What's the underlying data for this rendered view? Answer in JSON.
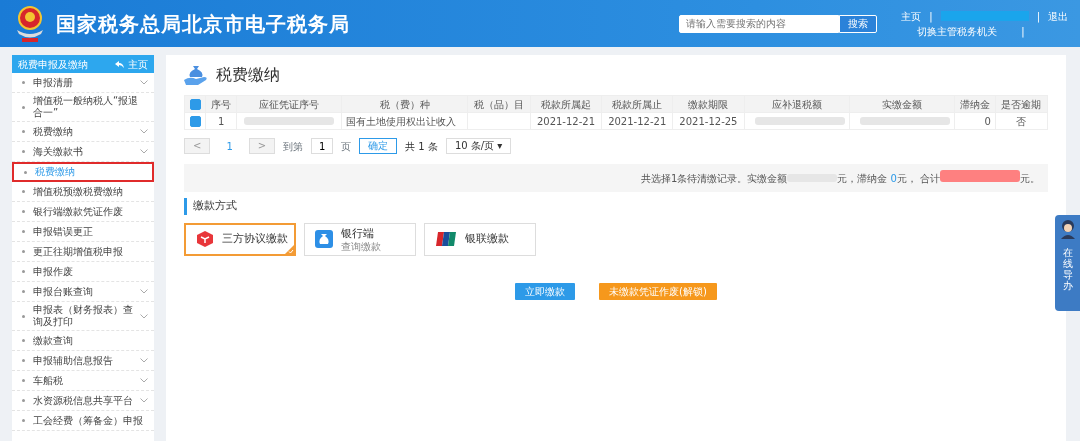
{
  "header": {
    "title": "国家税务总局北京市电子税务局",
    "search": {
      "placeholder": "请输入需要搜索的内容",
      "button": "搜索"
    },
    "links": [
      {
        "kind": "link",
        "text": "主页"
      },
      {
        "kind": "sep",
        "text": "|"
      },
      {
        "kind": "redacted"
      },
      {
        "kind": "sep",
        "text": "|"
      },
      {
        "kind": "link",
        "text": "退出"
      }
    ],
    "switch_link": "切换主管税务机关",
    "switch_sep": "|"
  },
  "sidebar": {
    "title": "税费申报及缴纳",
    "home": "主页",
    "items": [
      {
        "label": "申报清册",
        "expandable": true,
        "selected": false
      },
      {
        "label": "增值税一般纳税人“报退合一”",
        "expandable": false,
        "selected": false
      },
      {
        "label": "税费缴纳",
        "expandable": true,
        "selected": false
      },
      {
        "label": "海关缴款书",
        "expandable": true,
        "selected": false
      },
      {
        "label": "税费缴纳",
        "expandable": false,
        "selected": true
      },
      {
        "label": "增值税预缴税费缴纳",
        "expandable": false,
        "selected": false
      },
      {
        "label": "银行端缴款凭证作废",
        "expandable": false,
        "selected": false
      },
      {
        "label": "申报错误更正",
        "expandable": false,
        "selected": false
      },
      {
        "label": "更正往期增值税申报",
        "expandable": false,
        "selected": false
      },
      {
        "label": "申报作废",
        "expandable": false,
        "selected": false
      },
      {
        "label": "申报台账查询",
        "expandable": true,
        "selected": false
      },
      {
        "label": "申报表（财务报表）查询及打印",
        "expandable": true,
        "selected": false
      },
      {
        "label": "缴款查询",
        "expandable": false,
        "selected": false
      },
      {
        "label": "申报辅助信息报告",
        "expandable": true,
        "selected": false
      },
      {
        "label": "车船税",
        "expandable": true,
        "selected": false
      },
      {
        "label": "水资源税信息共享平台",
        "expandable": true,
        "selected": false
      },
      {
        "label": "工会经费（筹备金）申报",
        "expandable": false,
        "selected": false
      }
    ]
  },
  "page": {
    "title": "税费缴纳",
    "table": {
      "all_checked": true,
      "columns": [
        "序号",
        "应征凭证序号",
        "税（费）种",
        "税（品）目",
        "税款所属起",
        "税款所属止",
        "缴款期限",
        "应补退税额",
        "实缴金额",
        "滞纳金",
        "是否逾期"
      ],
      "rows": [
        {
          "checked": true,
          "cells": [
            {
              "text": "1"
            },
            {
              "redacted": true
            },
            {
              "text": "国有土地使用权出让收入"
            },
            {},
            {
              "text": "2021-12-21"
            },
            {
              "text": "2021-12-21"
            },
            {
              "text": "2021-12-25"
            },
            {
              "redacted": true
            },
            {
              "redacted": true
            },
            {
              "text": "0"
            },
            {
              "text": "否"
            }
          ]
        }
      ]
    },
    "pager": {
      "prev": "<",
      "page": "1",
      "next": ">",
      "goto_label": "到第",
      "goto_value": "1",
      "page_unit": "页",
      "confirm": "确定",
      "total": "共 1 条",
      "page_size": "10 条/页",
      "page_size_caret": "▾"
    },
    "summary": [
      {
        "kind": "text",
        "text": "共选择1条待清缴记录。实缴金额"
      },
      {
        "kind": "redacted"
      },
      {
        "kind": "text",
        "text": "元，滞纳金 "
      },
      {
        "kind": "link",
        "text": "0"
      },
      {
        "kind": "text",
        "text": "元， 合计"
      },
      {
        "kind": "redacted_big"
      },
      {
        "kind": "text",
        "text": "元。"
      }
    ],
    "methods_title": "缴款方式",
    "methods": [
      {
        "kind": "tripartite",
        "label": "三方协议缴款",
        "selected": true
      },
      {
        "kind": "bank",
        "label": "银行端",
        "sub": "查询缴款",
        "selected": false
      },
      {
        "kind": "card",
        "label": "银联缴款",
        "selected": false
      }
    ],
    "buttons": [
      {
        "kind": "primary",
        "label": "立即缴款"
      },
      {
        "kind": "warning",
        "label": "未缴款凭证作废(解锁)"
      }
    ]
  },
  "float_tab": {
    "label": "在线导办"
  }
}
